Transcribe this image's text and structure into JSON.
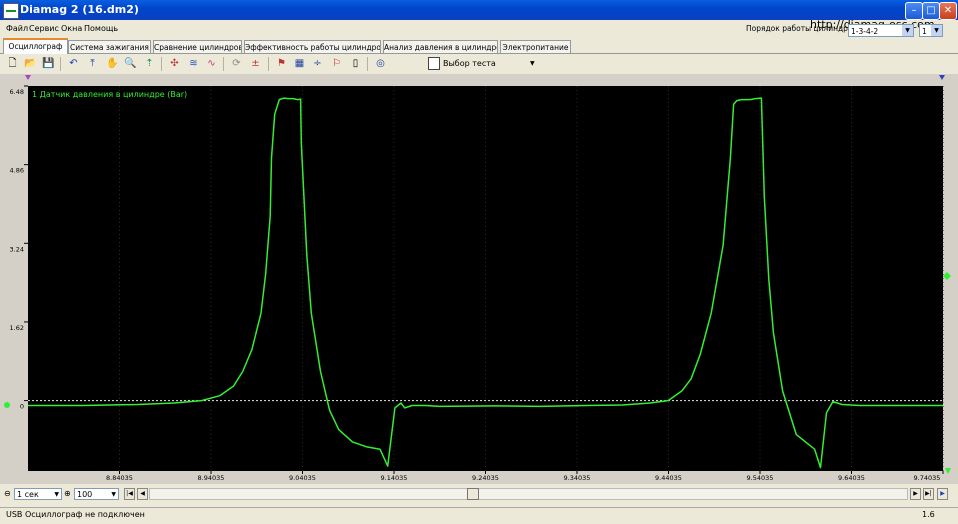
{
  "window": {
    "title": "Diamag 2 (16.dm2)",
    "url_text": "http://diamag-osc.com"
  },
  "menu": [
    "Файл",
    "Сервис",
    "Окна",
    "Помощь"
  ],
  "header_right": {
    "order_label": "Порядок работы цилиндров",
    "order_value": "1-3-4-2",
    "count_value": "1"
  },
  "tabs": [
    "Осциллограф",
    "Система зажигания",
    "Сравнение цилиндров",
    "Эффективность работы цилиндров",
    "Анализ давления в цилиндре",
    "Электропитание"
  ],
  "active_tab": "Осциллограф",
  "toolbar": {
    "test_select_label": "Выбор теста"
  },
  "icons": [
    "new-file-icon",
    "open-folder-icon",
    "save-icon",
    "cursor-icon",
    "measure-icon",
    "hand-icon",
    "zoom-icon",
    "marker-icon",
    "filter-icon",
    "wave-icon",
    "wave-compare-icon",
    "sync-icon",
    "zero-icon",
    "settings-icon",
    "table-icon",
    "split-icon",
    "flag-icon",
    "page-icon",
    "clock-icon",
    "document-icon"
  ],
  "plot": {
    "colors": {
      "background": "#000000",
      "trace": "#33ee33",
      "zero_line": "#e8e8e8"
    },
    "channel_label": "1 Датчик давления в цилиндре  (Bar)"
  },
  "controls": {
    "time_scale": "1 сек",
    "zoom_value": "100"
  },
  "status": {
    "left": "USB Осциллограф не подключен",
    "right": "1.6"
  },
  "chart_data": {
    "type": "line",
    "y_ticks": [
      "6.48",
      "4.86",
      "3.24",
      "1.62",
      "0"
    ],
    "x_ticks": [
      "8.84035",
      "8.94035",
      "9.04035",
      "9.14035",
      "9.24035",
      "9.34035",
      "9.44035",
      "9.54035",
      "9.64035",
      "9.74035"
    ],
    "xlim": [
      8.74035,
      9.74035
    ],
    "ylim": [
      -1.45,
      6.48
    ],
    "series": [
      {
        "x": [
          8.74035,
          8.8,
          8.86,
          8.9,
          8.93,
          8.95,
          8.965,
          8.975,
          8.985,
          8.995,
          9.0,
          9.005,
          9.0065,
          9.01,
          9.015,
          9.02,
          9.025,
          9.03,
          9.035,
          9.0383,
          9.039,
          9.045,
          9.05,
          9.06,
          9.07,
          9.08,
          9.095,
          9.11,
          9.125,
          9.1335,
          9.1413,
          9.148,
          9.152,
          9.16,
          9.175,
          9.19,
          9.25,
          9.3,
          9.35,
          9.39,
          9.42,
          9.44,
          9.455,
          9.465,
          9.475,
          9.487,
          9.5,
          9.508,
          9.5115,
          9.515,
          9.52,
          9.525,
          9.53,
          9.535,
          9.5419,
          9.545,
          9.55,
          9.555,
          9.565,
          9.58,
          9.6,
          9.6065,
          9.613,
          9.62,
          9.63,
          9.65,
          9.7,
          9.74035
        ],
        "y": [
          -0.1,
          -0.1,
          -0.08,
          -0.05,
          0.0,
          0.1,
          0.3,
          0.6,
          1.05,
          1.8,
          2.6,
          3.8,
          5.0,
          5.9,
          6.2,
          6.23,
          6.22,
          6.22,
          6.2,
          6.21,
          5.3,
          3.0,
          1.8,
          0.6,
          -0.2,
          -0.6,
          -0.85,
          -0.95,
          -1.0,
          -1.35,
          -0.15,
          -0.05,
          -0.15,
          -0.1,
          -0.1,
          -0.12,
          -0.11,
          -0.12,
          -0.1,
          -0.09,
          -0.05,
          0.0,
          0.2,
          0.45,
          0.95,
          1.8,
          3.2,
          5.0,
          6.1,
          6.18,
          6.2,
          6.2,
          6.2,
          6.22,
          6.23,
          4.2,
          2.5,
          1.4,
          0.2,
          -0.7,
          -1.0,
          -1.38,
          -0.25,
          -0.02,
          -0.08,
          -0.1,
          -0.1,
          -0.1
        ]
      }
    ]
  }
}
